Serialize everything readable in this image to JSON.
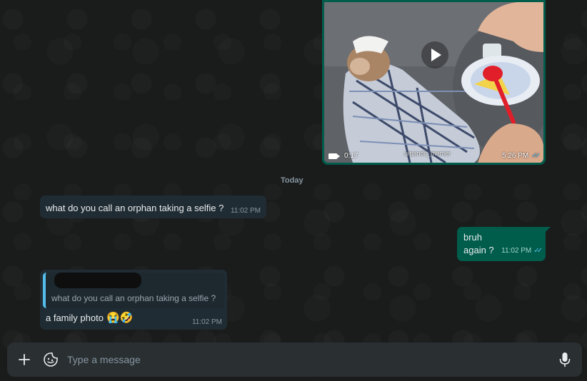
{
  "video_message": {
    "duration": "0:17",
    "watermark": "u/pandit_memer",
    "time": "5:26 PM",
    "ticks": "✓✓",
    "icons": [
      "play-icon",
      "video-camera-icon",
      "double-check-icon"
    ]
  },
  "date_divider": "Today",
  "messages": [
    {
      "direction": "incoming",
      "text": "what do you call an orphan taking a selfie ?",
      "time": "11:02 PM"
    },
    {
      "direction": "outgoing",
      "lines": [
        "bruh",
        "again ?"
      ],
      "time": "11:02 PM",
      "ticks": "✓✓"
    },
    {
      "direction": "incoming",
      "quoted_text": "what do you call an orphan taking a selfie ?",
      "text": "a family photo",
      "emoji": "😭🤣",
      "time": "11:02 PM"
    }
  ],
  "composer": {
    "placeholder": "Type a message",
    "icons": [
      "plus-icon",
      "sticker-icon",
      "microphone-icon"
    ]
  },
  "colors": {
    "background": "#1a1b1b",
    "incoming_bubble": "#202c33",
    "outgoing_bubble": "#005c4b",
    "read_ticks": "#53bdeb",
    "composer": "#2a2f32"
  }
}
